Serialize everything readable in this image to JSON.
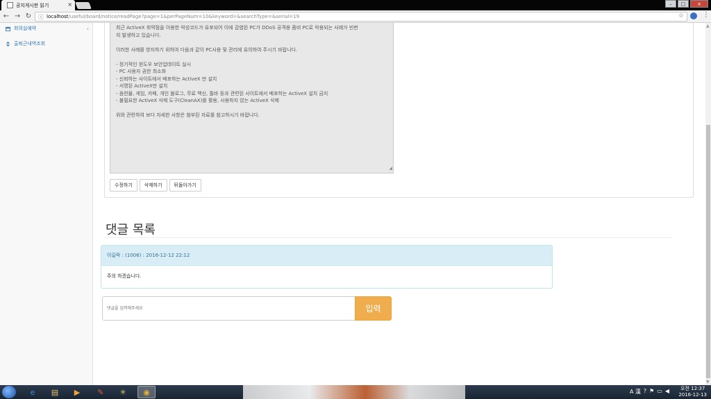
{
  "browser": {
    "tab_title": "공지게시판 읽기",
    "tab_close": "×",
    "url_host": "localhost",
    "url_path": "/useful/board/notice/readPage?page=1&perPageNum=10&keyword=&searchType=&serial=19",
    "star": "☆",
    "menu": "⋮",
    "win_min": "–",
    "win_max": "□",
    "win_close": "×"
  },
  "sidebar": {
    "items": [
      {
        "label": "회의실예약",
        "icon": "calendar-icon",
        "chevron": "‹"
      },
      {
        "label": "출퇴근내역조회",
        "icon": "sort-icon"
      }
    ]
  },
  "post": {
    "content_lines": [
      "최근 ActiveX 취약점을 이용한 악성코드가 유포되어 이에 감염된 PC가 DDoS 공격용 좀비 PC로 악용되는 사례가 빈번",
      "히 발생하고 있습니다.",
      "",
      "이러한 사례를 방지하기 위하여 다음과 같이 PC사용 및 관리에 유의하여 주시기 바랍니다.",
      "",
      "- 정기적인 윈도우 보안업데이트 실시",
      "- PC 사용자 권한 최소화",
      "- 신뢰하는 사이트에서 배포하는 ActiveX 만 설치",
      "- 서명된 ActiveX만 설치",
      "- 음란물, 게임, 카페, 개인 블로그, 무료 백신, 툴바 등과 관련된 사이트에서 배포하는 ActiveX 설치 금지",
      "- 불필요한 ActiveX 삭제 도구(CleanAX)를 활용, 사용하지 않는 ActiveX 삭제",
      "",
      "위와 관련하여 보다 자세한 사항은 첨부된 자료를 참고하시기 바랍니다."
    ],
    "buttons": {
      "edit": "수정하기",
      "delete": "삭제하기",
      "back": "뒤돌아가기"
    }
  },
  "comments": {
    "title": "댓글 목록",
    "items": [
      {
        "header": "이길락 : (1006) : 2016-12-12 22:12",
        "body": "주의 하겠습니다."
      }
    ],
    "reply_placeholder": "댓글을 입력해주세요",
    "submit_label": "입력"
  },
  "taskbar": {
    "clock_time": "오전 12:37",
    "clock_date": "2016-12-13",
    "tray_lang": "A 漢"
  }
}
